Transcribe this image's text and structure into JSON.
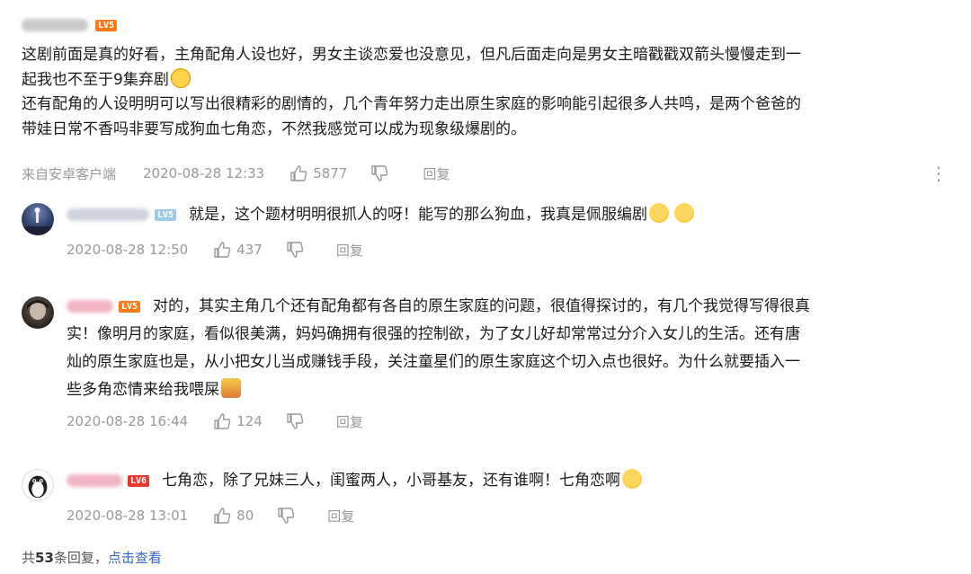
{
  "colors": {
    "meta": "#999999",
    "link": "#3366cc",
    "level_badge": "#ff7a1a",
    "level_badge_blue": "#9ec9ea",
    "level_badge_red": "#e8372e"
  },
  "main": {
    "level": "LV5",
    "text_lines": [
      "这剧前面是真的好看，主角配角人设也好，男女主谈恋爱也没意见，但凡后面走向是男女主暗戳戳双箭头慢慢走到一",
      "起我也不至于9集弃剧",
      "还有配角的人设明明可以写出很精彩的剧情的，几个青年努力走出原生家庭的影响能引起很多人共鸣，是两个爸爸的",
      "带娃日常不香吗非要写成狗血七角恋，不然我感觉可以成为现象级爆剧的。"
    ],
    "source": "来自安卓客户端",
    "time": "2020-08-28 12:33",
    "likes": "5877",
    "reply_label": "回复",
    "more_icon": "more-vertical-icon"
  },
  "replies": [
    {
      "level": "LV5",
      "text": "就是，这个题材明明很抓人的呀！能写的那么狗血，我真是佩服编剧",
      "time": "2020-08-28 12:50",
      "likes": "437",
      "reply_label": "回复"
    },
    {
      "level": "LV5",
      "text_first": "对的，其实主角几个还有配角都有各自的原生家庭的问题，很值得探讨的，有几个我觉得写得很真",
      "text_lines": [
        "实！像明月的家庭，看似很美满，妈妈确拥有很强的控制欲，为了女儿好却常常过分介入女儿的生活。还有唐",
        "灿的原生家庭也是，从小把女儿当成赚钱手段，关注童星们的原生家庭这个切入点也很好。为什么就要插入一",
        "些多角恋情来给我喂屎"
      ],
      "time": "2020-08-28 16:44",
      "likes": "124",
      "reply_label": "回复"
    },
    {
      "level": "LV6",
      "text": "七角恋，除了兄妹三人，闺蜜两人，小哥基友，还有谁啊！七角恋啊",
      "time": "2020-08-28 13:01",
      "likes": "80",
      "reply_label": "回复"
    }
  ],
  "footer": {
    "total_prefix": "共",
    "total_count": "53",
    "total_suffix": "条回复，",
    "view_link": "点击查看"
  }
}
